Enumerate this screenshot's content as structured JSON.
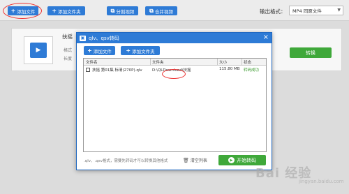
{
  "toolbar": {
    "add_file": "添加文件",
    "add_folder": "添加文件夹",
    "split_video": "分割视频",
    "merge_video": "合并视频",
    "output_format_label": "输出格式：",
    "output_format_value": "MP4 同原文件"
  },
  "file_card": {
    "title": "扶摇",
    "meta1": "格式",
    "meta2": "长度",
    "convert": "转换"
  },
  "dialog": {
    "title": "qlv、qsv转码",
    "add_file": "添加文件",
    "add_folder": "添加文件夹",
    "columns": {
      "name": "文件名",
      "folder": "文件夹",
      "size": "大小",
      "status": "状态"
    },
    "rows": [
      {
        "name": "扶摇 第01集 标清(270P).qlv",
        "folder": "D:\\QLDownload\\扶摇",
        "size": "115.80 MB",
        "status": "转码成功"
      }
    ],
    "hint": ".qlv、.qsv格式，需要先转码才可以转换其他格式",
    "clear": "清空列表",
    "start": "开始转码"
  },
  "watermark": {
    "main": "Bai 经验",
    "sub": "jingyan.baidu.com"
  },
  "colors": {
    "primary": "#2e7bd6",
    "success": "#3fa83a",
    "highlight": "#e33333"
  }
}
